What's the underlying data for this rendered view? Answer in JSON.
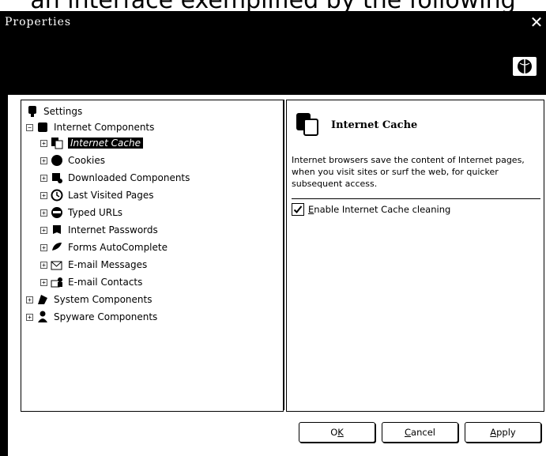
{
  "caption": "an interface exemplified by the following",
  "window": {
    "title": "Properties",
    "close_symbol": "✕"
  },
  "tree": {
    "root_label": "Settings",
    "group_label": "Internet Components",
    "items": [
      {
        "label": "Internet Cache",
        "icon": "internet-cache-icon",
        "selected": true
      },
      {
        "label": "Cookies",
        "icon": "cookies-icon"
      },
      {
        "label": "Downloaded Components",
        "icon": "downloaded-components-icon"
      },
      {
        "label": "Last Visited Pages",
        "icon": "last-visited-pages-icon"
      },
      {
        "label": "Typed URLs",
        "icon": "typed-urls-icon"
      },
      {
        "label": "Internet Passwords",
        "icon": "internet-passwords-icon"
      },
      {
        "label": "Forms AutoComplete",
        "icon": "forms-autocomplete-icon"
      },
      {
        "label": "E-mail Messages",
        "icon": "email-messages-icon"
      },
      {
        "label": "E-mail Contacts",
        "icon": "email-contacts-icon"
      }
    ],
    "system_label": "System Components",
    "spyware_label": "Spyware Components",
    "expander_symbol": "+",
    "collapse_symbol": "−"
  },
  "info": {
    "title": "Internet Cache",
    "description": "Internet browsers save the content of Internet pages, when you visit sites or surf the web, for quicker subsequent access.",
    "checkbox_label_prefix": "E",
    "checkbox_label_rest": "nable Internet Cache cleaning",
    "checkbox_checked": true
  },
  "buttons": {
    "ok_main": "O",
    "ok_underline": "K",
    "cancel_underline": "C",
    "cancel_rest": "ancel",
    "apply_underline": "A",
    "apply_rest": "pply"
  }
}
